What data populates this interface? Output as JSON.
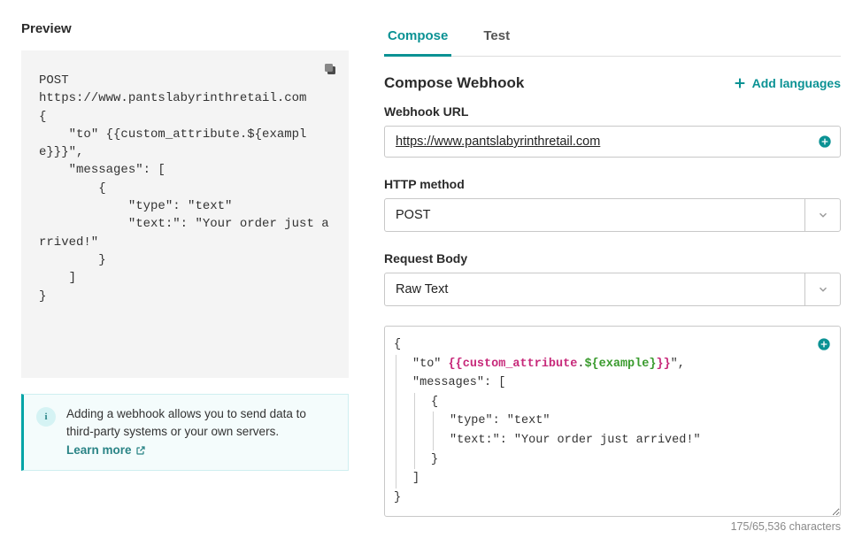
{
  "preview": {
    "title": "Preview",
    "code": "POST\nhttps://www.pantslabyrinthretail.com\n{\n    \"to\" {{custom_attribute.${example}}}\",\n    \"messages\": [\n        {\n            \"type\": \"text\"\n            \"text:\": \"Your order just arrived!\"\n        }\n    ]\n}",
    "info_text": "Adding a webhook allows you to send data to third-party systems or your own servers.",
    "learn_more": "Learn more"
  },
  "tabs": {
    "compose": "Compose",
    "test": "Test"
  },
  "compose": {
    "heading": "Compose Webhook",
    "add_languages": "Add languages",
    "url_label": "Webhook URL",
    "url_value": "https://www.pantslabyrinthretail.com",
    "method_label": "HTTP method",
    "method_value": "POST",
    "body_label": "Request Body",
    "body_type_value": "Raw Text",
    "body": {
      "line1_key": "\"to\"",
      "line1_liquid_open": "{{",
      "line1_var": "custom_attribute",
      "line1_dot": ".",
      "line1_expr": "${example}",
      "line1_liquid_close": "}}",
      "line1_tail": "\",",
      "line2": "\"messages\": [",
      "line3": "{",
      "line4": "\"type\": \"text\"",
      "line5": "\"text:\": \"Your order just arrived!\"",
      "line6": "}",
      "line7": "]",
      "line8_open": "{",
      "line8_close": "}"
    },
    "char_count": "175/65,536 characters"
  }
}
